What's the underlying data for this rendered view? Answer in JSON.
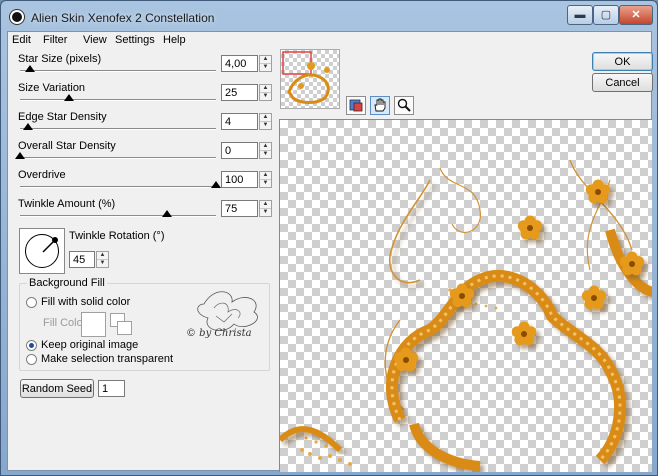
{
  "window": {
    "title": "Alien Skin Xenofex 2 Constellation",
    "min_glyph": "▬",
    "max_glyph": "▢",
    "close_glyph": "✕"
  },
  "menu": [
    "Edit",
    "Filter",
    "View",
    "Settings",
    "Help"
  ],
  "sliders": [
    {
      "label": "Star Size (pixels)",
      "value": "4,00",
      "level": 0.05
    },
    {
      "label": "Size Variation",
      "value": "25",
      "level": 0.25
    },
    {
      "label": "Edge Star Density",
      "value": "4",
      "level": 0.04
    },
    {
      "label": "Overall Star Density",
      "value": "0",
      "level": 0.0
    },
    {
      "label": "Overdrive",
      "value": "100",
      "level": 1.0
    },
    {
      "label": "Twinkle Amount (%)",
      "value": "75",
      "level": 0.75
    }
  ],
  "twinkle_rotation": {
    "label": "Twinkle Rotation (°)",
    "value": "45",
    "angle_deg": 45
  },
  "background_fill": {
    "title": "Background Fill",
    "options": [
      {
        "label": "Fill with solid color",
        "selected": false
      },
      {
        "label": "Keep original image",
        "selected": true
      },
      {
        "label": "Make selection transparent",
        "selected": false
      }
    ],
    "fill_color_label": "Fill Color"
  },
  "watermark_text": "© by Christa",
  "random_seed": {
    "label": "Random Seed",
    "value": "1"
  },
  "buttons": {
    "ok": "OK",
    "cancel": "Cancel"
  },
  "colors": {
    "accent": "#e09a22",
    "accent_dark": "#b06a08",
    "ornament": "#d98b12"
  }
}
